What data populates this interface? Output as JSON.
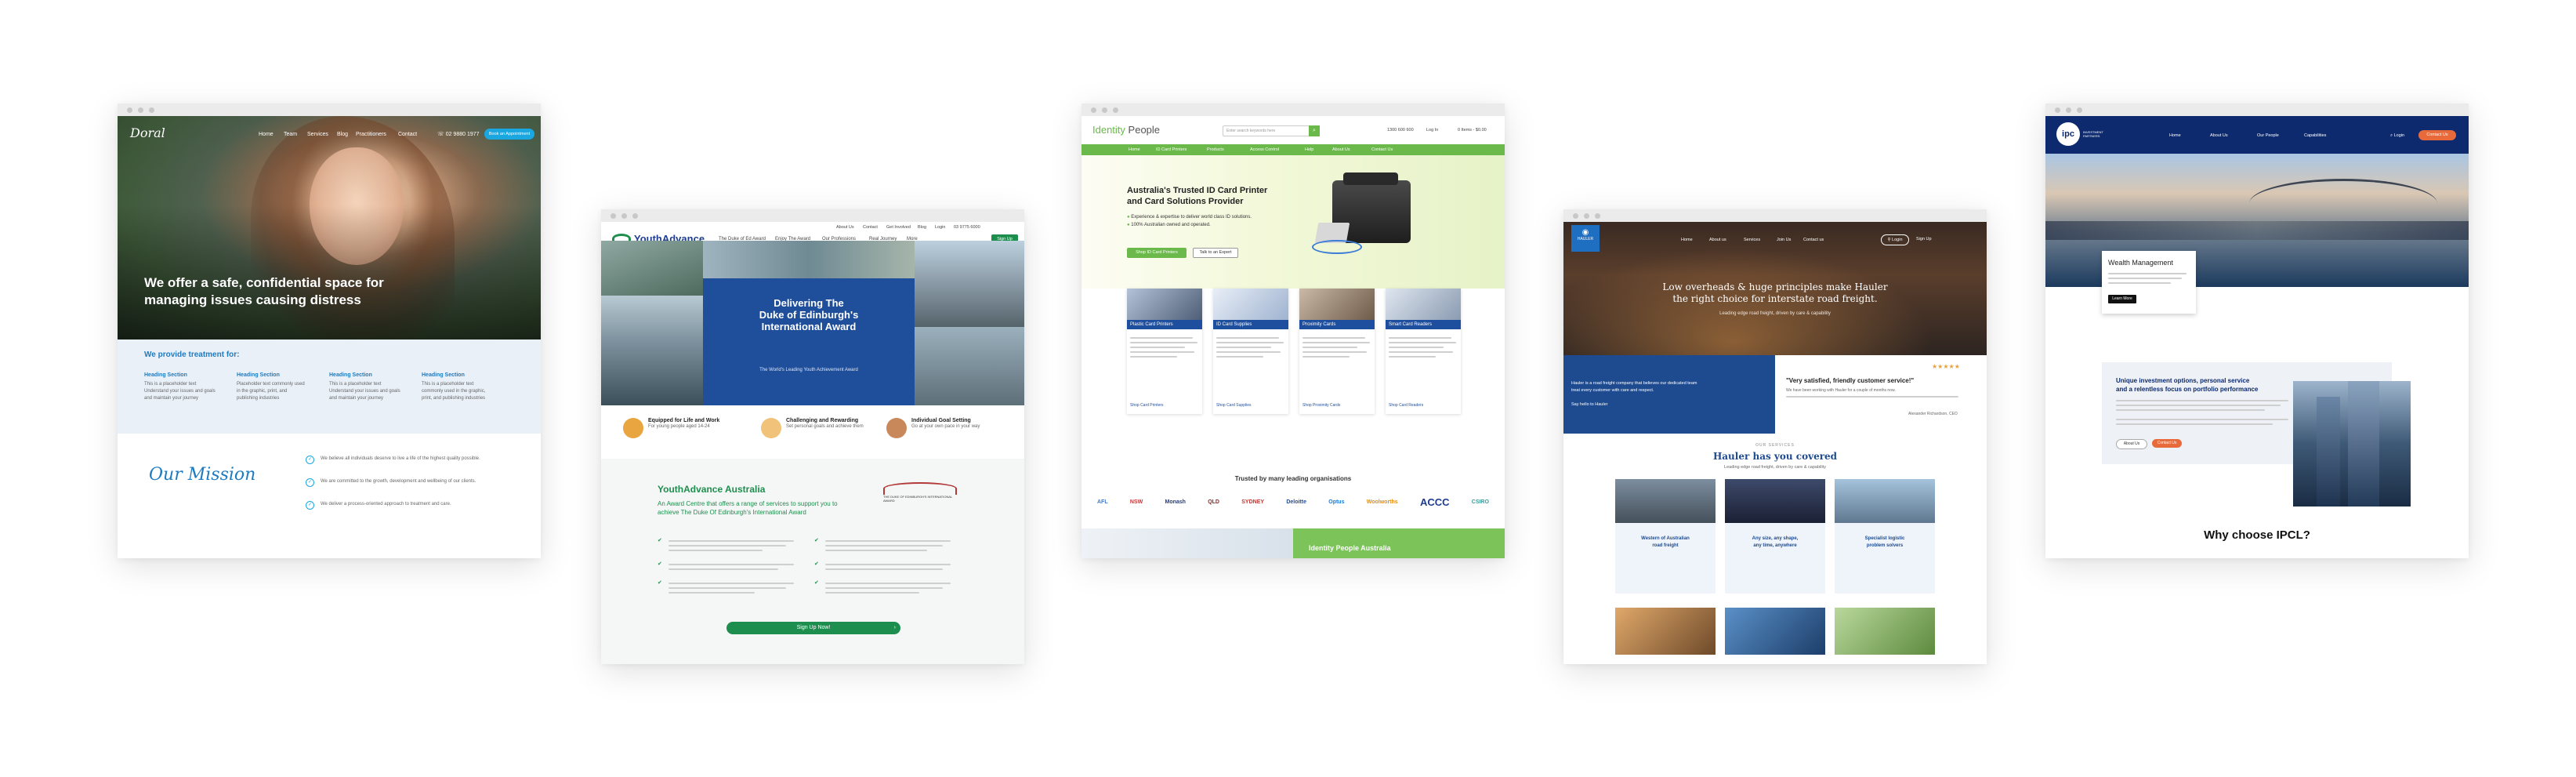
{
  "doral": {
    "logo": "Doral",
    "nav": [
      "Home",
      "Team",
      "Services",
      "Blog",
      "Practitioners",
      "Contact"
    ],
    "phone": "02 9880 1977",
    "cta": "Book an Appointment",
    "hero_title_1": "We offer a safe, confidential space for",
    "hero_title_2": "managing issues causing distress",
    "treatment_heading": "We provide treatment for:",
    "services": [
      {
        "title": "Heading Section",
        "text_1": "This is a placeholder text",
        "text_2": "Understand your issues and goals",
        "text_3": "and maintain your journey"
      },
      {
        "title": "Heading Section",
        "text_1": "Placeholder text commonly used",
        "text_2": "in the graphic, print, and",
        "text_3": "publishing industries"
      },
      {
        "title": "Heading Section",
        "text_1": "This is a placeholder text",
        "text_2": "Understand your issues and goals",
        "text_3": "and maintain your journey"
      },
      {
        "title": "Heading Section",
        "text_1": "This is a placeholder text",
        "text_2": "commonly used in the graphic,",
        "text_3": "print, and publishing industries"
      }
    ],
    "mission_heading": "Our Mission",
    "mission_points": [
      "We believe all individuals deserve to live a life of the highest quality possible.",
      "We are committed to the growth, development and wellbeing of our clients.",
      "We deliver a process-oriented approach to treatment and care."
    ]
  },
  "youth": {
    "top_links": [
      "About Us",
      "Contact",
      "Get Involved",
      "Blog",
      "Login"
    ],
    "phone": "03 9775 6000",
    "logo": "YouthAdvance",
    "nav": [
      "The Duke of Ed Award",
      "Enjoy The Award",
      "Our Professions",
      "Real Journey",
      "More"
    ],
    "nav_cta": "Sign Up",
    "hero_title_1": "Delivering The",
    "hero_title_2": "Duke of Edinburgh's",
    "hero_title_3": "International Award",
    "hero_sub": "The World's Leading Youth Achievement Award",
    "features": [
      {
        "title": "Equipped for Life and Work",
        "text": "For young people aged 14-24"
      },
      {
        "title": "Challenging and Rewarding",
        "text": "Set personal goals and achieve them"
      },
      {
        "title": "Individual Goal Setting",
        "text": "Go at your own pace in your way"
      }
    ],
    "section_title": "YouthAdvance Australia",
    "section_sub_1": "An Award Centre that offers a range of services to support you to",
    "section_sub_2": "achieve The Duke Of Edinburgh's International Award",
    "award_badge": "THE DUKE OF EDINBURGH'S INTERNATIONAL AWARD",
    "cta": "Sign Up Now!"
  },
  "identity": {
    "logo_1": "Identity",
    "logo_2": "People",
    "search_placeholder": "Enter search keywords here",
    "phone": "1300 600 600",
    "login": "Log In",
    "cart": "0 Items - $0.00",
    "nav": [
      "Home",
      "ID Card Printers",
      "Products",
      "Access Control",
      "Help",
      "About Us",
      "Contact Us"
    ],
    "hero_title_1": "Australia's Trusted ID Card Printer",
    "hero_title_2": "and Card Solutions Provider",
    "hero_points": [
      "Experience & expertise to deliver world class ID solutions.",
      "100% Australian owned and operated."
    ],
    "btn_primary": "Shop ID Card Printers",
    "btn_secondary": "Talk to an Expert",
    "products": [
      {
        "title": "Plastic Card Printers",
        "link": "Shop Card Printers"
      },
      {
        "title": "ID Card Supplies",
        "link": "Shop Card Supplies"
      },
      {
        "title": "Proximity Cards",
        "link": "Shop Proximity Cards"
      },
      {
        "title": "Smart Card Readers",
        "link": "Shop Card Readers"
      }
    ],
    "trusted": "Trusted by many leading organisations",
    "logos": [
      "AFL",
      "NSW",
      "Monash",
      "QLD",
      "SYDNEY",
      "Deloitte",
      "Optus",
      "Woolworths",
      "ACCC",
      "CSIRO"
    ],
    "footer_banner": "Identity People Australia"
  },
  "hauler": {
    "logo": "HAULER",
    "nav": [
      "Home",
      "About us",
      "Services",
      "Join Us",
      "Contact us"
    ],
    "login": "Login",
    "signup": "Sign Up",
    "hero_title_1": "Low overheads & huge principles make Hauler",
    "hero_title_2": "the right choice for interstate road freight.",
    "hero_sub": "Leading edge road freight, driven by care & capability",
    "about_text_1": "Hauler is a road freight company that believes our dedicated team",
    "about_text_2": "treat every customer with care and respect.",
    "about_link": "Say hello to Hauler",
    "stars": "★★★★★",
    "testimonial_1": "\"Very satisfied, friendly customer service!\"",
    "testimonial_body": "We have been working with Hauler for a couple of months now.",
    "testimonial_author": "Alexander Richardson, CEO",
    "services_eyebrow": "OUR SERVICES",
    "services_title": "Hauler has you covered",
    "services_sub": "Leading edge road freight, driven by care & capability",
    "service_cards": [
      {
        "title_1": "Western of Australian",
        "title_2": "road freight"
      },
      {
        "title_1": "Any size, any shape,",
        "title_2": "any time, anywhere"
      },
      {
        "title_1": "Specialist logistic",
        "title_2": "problem solvers"
      }
    ]
  },
  "ipc": {
    "logo": "ipc",
    "logo_sub": "INVESTMENT PARTNERS",
    "nav": [
      "Home",
      "About Us",
      "Our People",
      "Capabilities"
    ],
    "login": "Login",
    "cta": "Contact Us",
    "hero_box_title": "Wealth Management",
    "hero_box_btn": "Learn More",
    "section_title_1": "Unique investment options, personal service",
    "section_title_2": "and a relentless focus on portfolio performance",
    "section_btn_1": "About Us",
    "section_btn_2": "Contact Us",
    "why_title": "Why choose IPCL?"
  }
}
